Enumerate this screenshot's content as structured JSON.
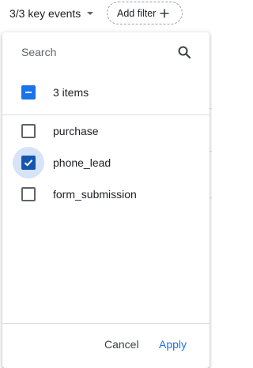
{
  "topbar": {
    "key_events_label": "3/3 key events",
    "key_events_icon": "caret-down-icon",
    "add_filter_label": "Add filter",
    "add_filter_icon": "plus-icon"
  },
  "dropdown": {
    "search": {
      "placeholder": "Search",
      "value": "",
      "icon": "search-icon"
    },
    "select_all": {
      "label": "3 items",
      "state": "indeterminate"
    },
    "items": [
      {
        "label": "purchase",
        "checked": false,
        "focused": false
      },
      {
        "label": "phone_lead",
        "checked": true,
        "focused": true
      },
      {
        "label": "form_submission",
        "checked": false,
        "focused": false
      }
    ],
    "footer": {
      "cancel_label": "Cancel",
      "apply_label": "Apply"
    }
  },
  "colors": {
    "accent": "#1a73e8",
    "checked_dark": "#1557b0",
    "focus_ring": "#d6e3f8",
    "text": "#202124",
    "divider": "#dadce0"
  }
}
